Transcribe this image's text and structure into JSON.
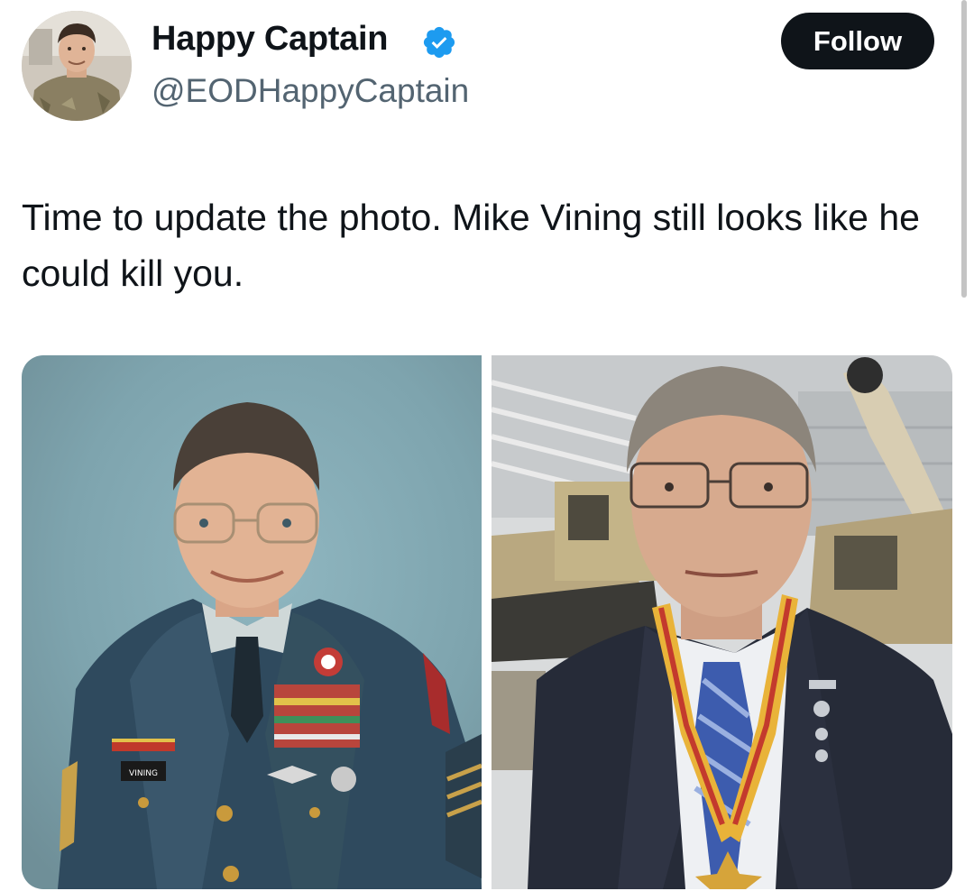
{
  "author": {
    "display_name": "Happy Captain",
    "handle": "@EODHappyCaptain",
    "verified": true,
    "verified_icon": "verified-badge-icon",
    "avatar": "profile-photo-soldier"
  },
  "follow_button": {
    "label": "Follow"
  },
  "tweet": {
    "text": "Time to update the photo. Mike Vining still looks like he could kill you."
  },
  "media": {
    "count": 2,
    "images": [
      {
        "subject": "soldier-dress-uniform-portrait",
        "name_tag": "VINING"
      },
      {
        "subject": "man-suit-medal-museum-portrait"
      }
    ]
  },
  "colors": {
    "text": "#0f1419",
    "secondary_text": "#536471",
    "verified_blue": "#1d9bf0",
    "button_bg": "#0f1419",
    "button_text": "#ffffff"
  }
}
